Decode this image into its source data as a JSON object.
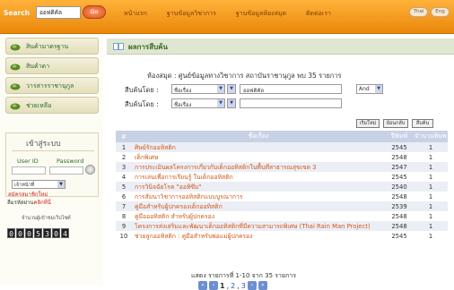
{
  "topbar": {
    "search_label": "Search",
    "search_value": "ออฟติคัล",
    "go_label": "Go",
    "nav": [
      "หน้าแรก",
      "ฐานข้อมูลวิชาการ",
      "ฐานข้อมูลห้องสมุด",
      "ติดต่อเรา"
    ],
    "pills": [
      "Thai",
      "Eng"
    ]
  },
  "sidebar": {
    "menu": [
      "สินค้ามาตรฐาน",
      "สินค้าดา",
      "วารสารราชานุกูล",
      "ช่วยเหลือ"
    ],
    "login": {
      "title": "เข้าสู่ระบบ",
      "user_id_label": "User ID",
      "password_label": "Password",
      "role_value": "เจ้าหน้าที่",
      "register_link": "สมัครสมาชิกใหม่",
      "forgot_prefix": "ลืมรหัสผ่าน",
      "forgot_link": "คลิกที่นี่"
    },
    "visitor_label": "จำนวนผู้เข้าชมเว็บไซต์",
    "counter": [
      "0",
      "0",
      "0",
      "5",
      "3",
      "0",
      "4"
    ]
  },
  "main": {
    "heading": "ผลการสืบค้น",
    "library_line": "ห้องสมุด : ศูนย์ข้อมูลทางวิชาการ สถาบันราชานุกูล พบ 35 รายการ",
    "search_row1": {
      "label": "สืบค้นโดย :",
      "field": "ชื่อเรื่อง",
      "term": "ออฟติคัล",
      "op": "And"
    },
    "search_row2": {
      "label": "สืบค้นโดย :",
      "field": "ชื่อเรื่อง",
      "term": ""
    },
    "buttons": [
      "เริ่มใหม่",
      "ย้อนกลับ",
      "สืบค้น"
    ],
    "table": {
      "headers": {
        "num": "#",
        "title": "ชื่อเรื่อง",
        "year": "ปีพิมพ์",
        "copies": "จำนวนพิมพ"
      },
      "rows": [
        {
          "num": "1",
          "title": "ศิษย์รักออทิสติก",
          "year": "2545",
          "copies": "1"
        },
        {
          "num": "2",
          "title": "เด็กพิเศษ",
          "year": "2548",
          "copies": "1"
        },
        {
          "num": "3",
          "title": "การประเมินผลโครงการเกี่ยวกับเด็กออทิสติกในพื้นที่สาธารณสุขเขต 3",
          "year": "2547",
          "copies": "1"
        },
        {
          "num": "4",
          "title": "การเล่นเพื่อการเรียนรู้ ในเด็กออทิสติก",
          "year": "2545",
          "copies": "1"
        },
        {
          "num": "5",
          "title": "การวินิจฉัยโรค \"ออทิซึม\"",
          "year": "2540",
          "copies": "1"
        },
        {
          "num": "6",
          "title": "การสัมนาวิชาการออทิสติกแบบบูรณาการ",
          "year": "2548",
          "copies": "1"
        },
        {
          "num": "7",
          "title": "คู่มือสำหรับผู้ปกครองเด็กออทิสติก",
          "year": "2539",
          "copies": "1"
        },
        {
          "num": "8",
          "title": "คู่มือออทิสติก สำหรับผู้ปกครอง",
          "year": "2548",
          "copies": "1"
        },
        {
          "num": "9",
          "title": "โครงการส่งเสริมและพัฒนาเด็กออทิสติกที่มีความสามารถพิเศษ (Thai Rain Man Project)",
          "year": "2548",
          "copies": "1"
        },
        {
          "num": "10",
          "title": "ช่วยลูกออทิสติก : คู่มือสำหรับพ่อแม่ผู้ปกครอง",
          "year": "2545",
          "copies": "1"
        }
      ]
    },
    "pager_text": "แสดง รายการที่ 1-10 จาก 35 รายการ",
    "pages": [
      "1",
      "2",
      "3"
    ]
  },
  "colors": {
    "orange_bar": "#f2a020",
    "title_link": "#d05a18",
    "table_head": "#c8d2e6"
  }
}
